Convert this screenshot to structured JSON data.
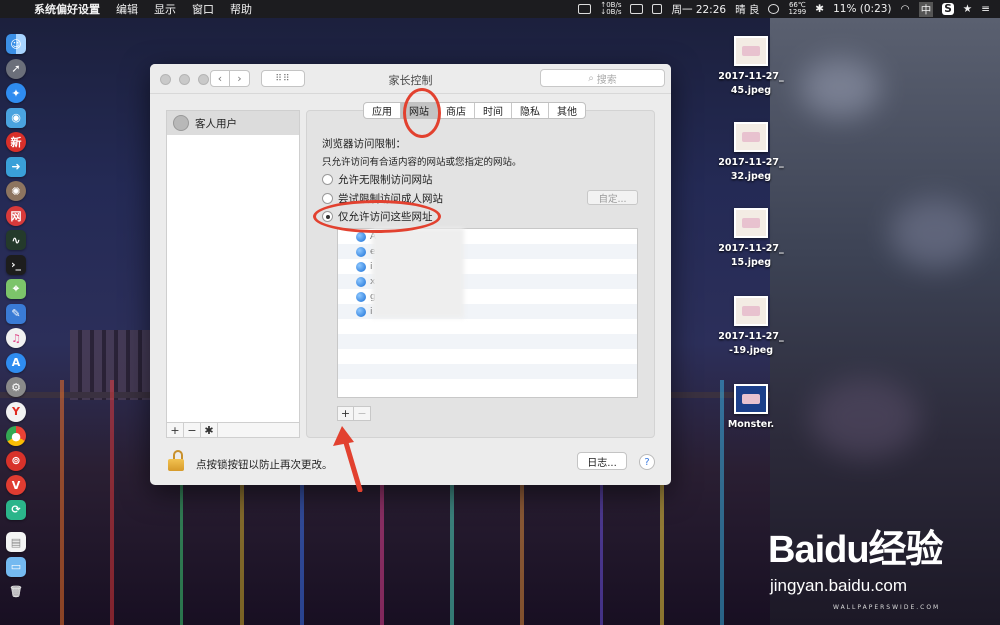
{
  "menubar": {
    "app_name": "系统偏好设置",
    "menus": [
      "编辑",
      "显示",
      "窗口",
      "帮助"
    ],
    "net_up": "↑0B/s",
    "net_down": "↓0B/s",
    "temp": "66℃",
    "rpm": "1299",
    "clock": "周一 22:26",
    "weather": "晴 良",
    "battery": "11% (0:23)",
    "input": "中"
  },
  "window": {
    "title": "家长控制",
    "search_placeholder": "搜索",
    "user": "客人用户",
    "tabs": [
      "应用",
      "网站",
      "商店",
      "时间",
      "隐私",
      "其他"
    ],
    "active_tab": "网站",
    "section_title": "浏览器访问限制：",
    "section_desc": "只允许访问有合适内容的网站或您指定的网站。",
    "options": [
      "允许无限制访问网站",
      "尝试限制访问成人网站",
      "仅允许访问这些网址"
    ],
    "selected_option": "仅允许访问这些网址",
    "customize_label": "自定...",
    "site_rows": [
      "A",
      "e",
      "i",
      "x",
      "g",
      "i"
    ],
    "lock_text": "点按锁按钮以防止再次更改。",
    "log_label": "日志...",
    "help_label": "?"
  },
  "desktop": {
    "files": [
      {
        "line1": "2017-11-27_",
        "line2": "45.jpeg"
      },
      {
        "line1": "2017-11-27_",
        "line2": "32.jpeg"
      },
      {
        "line1": "2017-11-27_",
        "line2": "15.jpeg"
      },
      {
        "line1": "2017-11-27_",
        "line2": "-19.jpeg"
      }
    ],
    "monster_label": "Monster."
  },
  "watermark": {
    "brand": "Baidu经验",
    "url": "jingyan.baidu.com",
    "wallpaper": "WALLPAPERSWIDE.COM"
  },
  "colors": {
    "annotation": "#e2412f",
    "accent": "#3a7ae0"
  }
}
